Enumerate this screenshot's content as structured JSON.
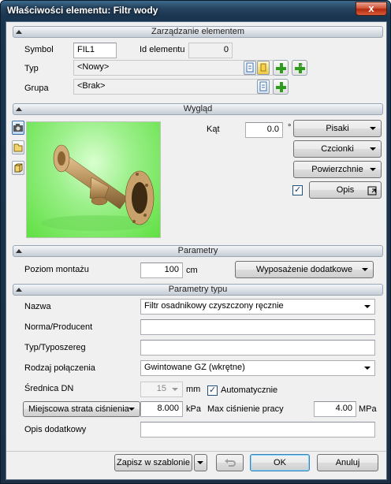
{
  "window": {
    "title": "Właściwości elementu: Filtr wody",
    "close_glyph": "x"
  },
  "sections": {
    "management": "Zarządzanie elementem",
    "appearance": "Wygląd",
    "parameters": "Parametry",
    "type_parameters": "Parametry typu"
  },
  "management": {
    "symbol_label": "Symbol",
    "symbol_value": "FIL1",
    "id_label": "Id elementu",
    "id_value": "0",
    "type_label": "Typ",
    "type_value": "<Nowy>",
    "group_label": "Grupa",
    "group_value": "<Brak>",
    "checkmark_glyph": "✓"
  },
  "appearance": {
    "angle_label": "Kąt",
    "angle_value": "0.0",
    "angle_unit": "°",
    "pens_button": "Pisaki",
    "fonts_button": "Czcionki",
    "surfaces_button": "Powierzchnie",
    "description_button": "Opis",
    "description_checked": true,
    "preview_colors": {
      "background": "#5fe042",
      "pipe": "#b58f5a"
    }
  },
  "parameters": {
    "mount_level_label": "Poziom montażu",
    "mount_level_value": "100",
    "mount_level_unit": "cm",
    "extra_equipment_button": "Wyposażenie dodatkowe"
  },
  "type_params": {
    "name_label": "Nazwa",
    "name_value": "Filtr osadnikowy czyszczony ręcznie",
    "norm_label": "Norma/Producent",
    "norm_value": "",
    "series_label": "Typ/Typoszereg",
    "series_value": "",
    "connection_label": "Rodzaj połączenia",
    "connection_value": "Gwintowane GZ (wkrętne)",
    "dn_label": "Średnica DN",
    "dn_value": "15",
    "dn_unit": "mm",
    "auto_label": "Automatycznie",
    "auto_checked": true,
    "loss_type_value": "Miejscowa strata ciśnienia",
    "loss_value": "8.000",
    "loss_unit": "kPa",
    "max_pressure_label": "Max ciśnienie pracy",
    "max_pressure_value": "4.00",
    "max_pressure_unit": "MPa",
    "extra_desc_label": "Opis dodatkowy",
    "extra_desc_value": ""
  },
  "footer": {
    "save_template_button": "Zapisz w szablonie",
    "ok_button": "OK",
    "cancel_button": "Anuluj"
  }
}
